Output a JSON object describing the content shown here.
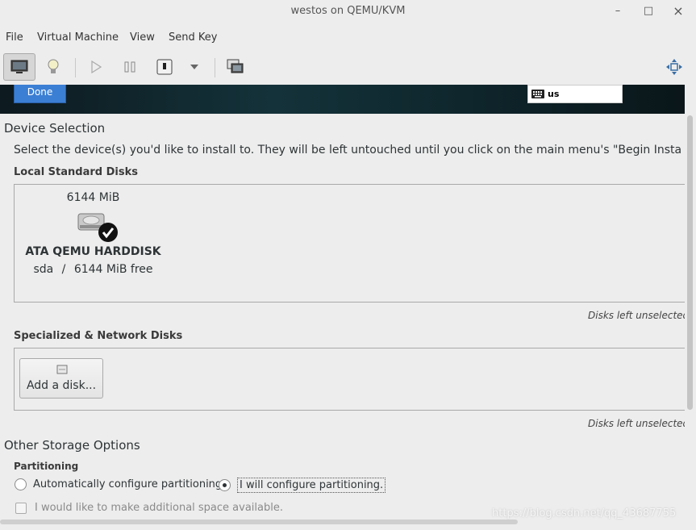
{
  "window": {
    "title": "westos on QEMU/KVM",
    "minimize": "–",
    "maximize": "□",
    "close": "×"
  },
  "menubar": [
    "File",
    "Virtual Machine",
    "View",
    "Send Key"
  ],
  "installer": {
    "done_label": "Done",
    "keyboard_layout": "us"
  },
  "device_selection": {
    "heading": "Device Selection",
    "instructions": "Select the device(s) you'd like to install to.  They will be left untouched until you click on the main menu's \"Begin Insta",
    "local_heading": "Local Standard Disks",
    "disk": {
      "size": "6144 MiB",
      "model": "ATA QEMU HARDDISK",
      "device": "sda",
      "separator": "/",
      "free": "6144 MiB free",
      "selected": true
    },
    "local_note": "Disks left unselected",
    "specialized_heading": "Specialized & Network Disks",
    "add_disk_label": "Add a disk...",
    "specialized_note": "Disks left unselected"
  },
  "other_storage": {
    "heading": "Other Storage Options",
    "partitioning_heading": "Partitioning",
    "auto_label": "Automatically configure partitioning.",
    "manual_label": "I will configure partitioning.",
    "selected": "manual",
    "space_label": "I would like to make additional space available."
  },
  "watermark": "https://blog.csdn.net/qq_43687755",
  "colors": {
    "accent": "#3b7fd4",
    "header_bg": "#14323a",
    "window_bg": "#ededed"
  }
}
